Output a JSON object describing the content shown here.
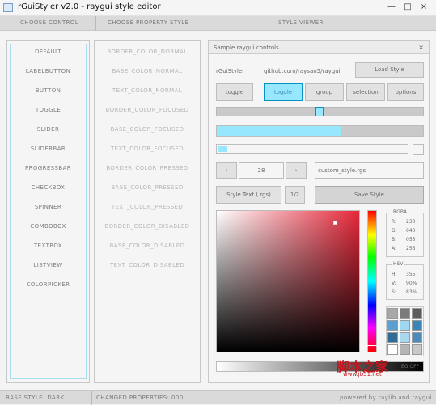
{
  "window": {
    "title": "rGuiStyler v2.0 - raygui style editor",
    "minimize": "—",
    "maximize": "□",
    "close": "×"
  },
  "tabs": {
    "choose_control": "CHOOSE CONTROL",
    "choose_property": "CHOOSE PROPERTY STYLE",
    "style_viewer": "STYLE VIEWER"
  },
  "controls": [
    "DEFAULT",
    "LABELBUTTON",
    "BUTTON",
    "TOGGLE",
    "SLIDER",
    "SLIDERBAR",
    "PROGRESSBAR",
    "CHECKBOX",
    "SPINNER",
    "COMBOBOX",
    "TEXTBOX",
    "LISTVIEW",
    "COLORPICKER"
  ],
  "properties": [
    "BORDER_COLOR_NORMAL",
    "BASE_COLOR_NORMAL",
    "TEXT_COLOR_NORMAL",
    "BORDER_COLOR_FOCUSED",
    "BASE_COLOR_FOCUSED",
    "TEXT_COLOR_FOCUSED",
    "BORDER_COLOR_PRESSED",
    "BASE_COLOR_PRESSED",
    "TEXT_COLOR_PRESSED",
    "BORDER_COLOR_DISABLED",
    "BASE_COLOR_DISABLED",
    "TEXT_COLOR_DISABLED"
  ],
  "viewer": {
    "title": "Sample raygui controls",
    "close": "×",
    "label": "rGuiStyler",
    "link": "github.com/raysan5/raygui",
    "load_style": "Load Style",
    "toggles": [
      "toggle",
      "toggle",
      "group",
      "selection",
      "options"
    ],
    "slider_value": 0.48,
    "progress_value": 0.6,
    "sliderbar_value": 0.05,
    "spinner": {
      "dec": "‹",
      "value": "28",
      "inc": "›"
    },
    "textbox": "custom_style.rgs",
    "style_text": "Style Text (.rgs)",
    "combo": "1/2",
    "save_style": "Save Style",
    "rgba_title": "RGBA",
    "rgba": [
      {
        "k": "R:",
        "v": "230"
      },
      {
        "k": "G:",
        "v": "040"
      },
      {
        "k": "B:",
        "v": "055"
      },
      {
        "k": "A:",
        "v": "255"
      }
    ],
    "hsv_title": "HSV",
    "hsv": [
      {
        "k": "H:",
        "v": "355"
      },
      {
        "k": "V:",
        "v": "90%"
      },
      {
        "k": "S:",
        "v": "83%"
      }
    ],
    "palette": [
      "#a8a8a8",
      "#7a7a7a",
      "#5c5c5c",
      "#5a9fd0",
      "#9fd8f3",
      "#3b86b6",
      "#2e6b95",
      "#a9d7ee",
      "#4c8cba",
      "#ffffff",
      "#b5b5b5",
      "#c9c9c9"
    ],
    "colors": {
      "accent": "#97e8ff",
      "accent_border": "#0492c7"
    }
  },
  "status": {
    "base_style": "BASE STYLE: DARK",
    "changed": "CHANGED PROPERTIES: 000",
    "powered": "powered by raylib and raygui"
  },
  "watermark": {
    "cn": "脚本之家",
    "url": "www.jb51.net",
    "overlay": "EG OFF"
  }
}
